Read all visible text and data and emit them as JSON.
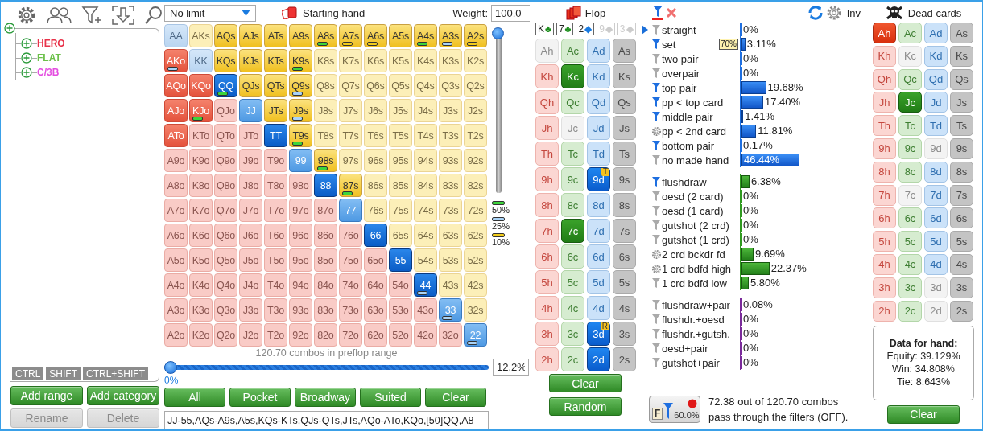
{
  "tree": {
    "items": [
      {
        "label": "HERO",
        "color": "#e8334a"
      },
      {
        "label": "FLAT",
        "color": "#6cc04a"
      },
      {
        "label": "C/3B",
        "color": "#e44ee0"
      }
    ]
  },
  "modifier_keys": [
    "CTRL",
    "SHIFT",
    "CTRL+SHIFT"
  ],
  "range_buttons": [
    {
      "label": "Add range",
      "disabled": false
    },
    {
      "label": "Add category",
      "disabled": false
    },
    {
      "label": "Rename",
      "disabled": true
    },
    {
      "label": "Delete",
      "disabled": true
    }
  ],
  "range": {
    "mode_dropdown": "No limit",
    "title": "Starting hand",
    "weight_label": "Weight:",
    "weight_value": "100.0",
    "weight_slider": {
      "level": 1
    },
    "legend": [
      {
        "label": "50%",
        "color": "#3cd43c"
      },
      {
        "label": "25%",
        "color": "#a9d3f7"
      },
      {
        "label": "10%",
        "color": "#f2cc1a"
      }
    ],
    "grid": [
      [
        {
          "label": "AA",
          "kind": "pair",
          "selected": false
        },
        {
          "label": "AKs",
          "kind": "suited",
          "selected": false
        },
        {
          "label": "AQs",
          "kind": "suited",
          "selected": true
        },
        {
          "label": "AJs",
          "kind": "suited",
          "selected": true
        },
        {
          "label": "ATs",
          "kind": "suited",
          "selected": true
        },
        {
          "label": "A9s",
          "kind": "suited",
          "selected": true
        },
        {
          "label": "A8s",
          "kind": "suited",
          "selected": true,
          "marker": {
            "color": "#3cd43c"
          }
        },
        {
          "label": "A7s",
          "kind": "suited",
          "selected": true,
          "marker": {
            "color": "#f2cc1a"
          }
        },
        {
          "label": "A6s",
          "kind": "suited",
          "selected": true,
          "marker": {
            "color": "#f2cc1a"
          }
        },
        {
          "label": "A5s",
          "kind": "suited",
          "selected": true
        },
        {
          "label": "A4s",
          "kind": "suited",
          "selected": true,
          "marker": {
            "color": "#3cd43c"
          }
        },
        {
          "label": "A3s",
          "kind": "suited",
          "selected": true,
          "marker": {
            "color": "#a9d3f7"
          }
        },
        {
          "label": "A2s",
          "kind": "suited",
          "selected": true,
          "marker": {
            "color": "#f2cc1a"
          }
        }
      ],
      [
        {
          "label": "AKo",
          "kind": "offsuit",
          "selected": true,
          "marker": {
            "color": "#a9d3f7"
          }
        },
        {
          "label": "KK",
          "kind": "pair",
          "selected": false
        },
        {
          "label": "KQs",
          "kind": "suited",
          "selected": true
        },
        {
          "label": "KJs",
          "kind": "suited",
          "selected": true
        },
        {
          "label": "KTs",
          "kind": "suited",
          "selected": true
        },
        {
          "label": "K9s",
          "kind": "suited",
          "selected": true,
          "marker": {
            "color": "#3cd43c"
          }
        },
        {
          "label": "K8s",
          "kind": "suited",
          "selected": false
        },
        {
          "label": "K7s",
          "kind": "suited",
          "selected": false
        },
        {
          "label": "K6s",
          "kind": "suited",
          "selected": false
        },
        {
          "label": "K5s",
          "kind": "suited",
          "selected": false
        },
        {
          "label": "K4s",
          "kind": "suited",
          "selected": false
        },
        {
          "label": "K3s",
          "kind": "suited",
          "selected": false
        },
        {
          "label": "K2s",
          "kind": "suited",
          "selected": false
        }
      ],
      [
        {
          "label": "AQo",
          "kind": "offsuit",
          "selected": true
        },
        {
          "label": "KQo",
          "kind": "offsuit",
          "selected": true
        },
        {
          "label": "QQ",
          "kind": "pair",
          "selected": true,
          "partial": false,
          "marker": {
            "color": "#3cd43c"
          }
        },
        {
          "label": "QJs",
          "kind": "suited",
          "selected": true
        },
        {
          "label": "QTs",
          "kind": "suited",
          "selected": true
        },
        {
          "label": "Q9s",
          "kind": "suited",
          "selected": true,
          "marker": {
            "color": "#a9d3f7"
          }
        },
        {
          "label": "Q8s",
          "kind": "suited",
          "selected": false
        },
        {
          "label": "Q7s",
          "kind": "suited",
          "selected": false
        },
        {
          "label": "Q6s",
          "kind": "suited",
          "selected": false
        },
        {
          "label": "Q5s",
          "kind": "suited",
          "selected": false
        },
        {
          "label": "Q4s",
          "kind": "suited",
          "selected": false
        },
        {
          "label": "Q3s",
          "kind": "suited",
          "selected": false
        },
        {
          "label": "Q2s",
          "kind": "suited",
          "selected": false
        }
      ],
      [
        {
          "label": "AJo",
          "kind": "offsuit",
          "selected": true
        },
        {
          "label": "KJo",
          "kind": "offsuit",
          "selected": true,
          "marker": {
            "color": "#3cd43c"
          }
        },
        {
          "label": "QJo",
          "kind": "offsuit",
          "selected": false
        },
        {
          "label": "JJ",
          "kind": "pair",
          "selected": true,
          "partial": true
        },
        {
          "label": "JTs",
          "kind": "suited",
          "selected": true
        },
        {
          "label": "J9s",
          "kind": "suited",
          "selected": true,
          "marker": {
            "color": "#a9d3f7"
          }
        },
        {
          "label": "J8s",
          "kind": "suited",
          "selected": false
        },
        {
          "label": "J7s",
          "kind": "suited",
          "selected": false
        },
        {
          "label": "J6s",
          "kind": "suited",
          "selected": false
        },
        {
          "label": "J5s",
          "kind": "suited",
          "selected": false
        },
        {
          "label": "J4s",
          "kind": "suited",
          "selected": false
        },
        {
          "label": "J3s",
          "kind": "suited",
          "selected": false
        },
        {
          "label": "J2s",
          "kind": "suited",
          "selected": false
        }
      ],
      [
        {
          "label": "ATo",
          "kind": "offsuit",
          "selected": true
        },
        {
          "label": "KTo",
          "kind": "offsuit",
          "selected": false
        },
        {
          "label": "QTo",
          "kind": "offsuit",
          "selected": false
        },
        {
          "label": "JTo",
          "kind": "offsuit",
          "selected": false
        },
        {
          "label": "TT",
          "kind": "pair",
          "selected": true,
          "partial": false
        },
        {
          "label": "T9s",
          "kind": "suited",
          "selected": true,
          "marker": {
            "color": "#3cd43c"
          }
        },
        {
          "label": "T8s",
          "kind": "suited",
          "selected": false
        },
        {
          "label": "T7s",
          "kind": "suited",
          "selected": false
        },
        {
          "label": "T6s",
          "kind": "suited",
          "selected": false
        },
        {
          "label": "T5s",
          "kind": "suited",
          "selected": false
        },
        {
          "label": "T4s",
          "kind": "suited",
          "selected": false
        },
        {
          "label": "T3s",
          "kind": "suited",
          "selected": false
        },
        {
          "label": "T2s",
          "kind": "suited",
          "selected": false
        }
      ],
      [
        {
          "label": "A9o",
          "kind": "offsuit",
          "selected": false
        },
        {
          "label": "K9o",
          "kind": "offsuit",
          "selected": false
        },
        {
          "label": "Q9o",
          "kind": "offsuit",
          "selected": false
        },
        {
          "label": "J9o",
          "kind": "offsuit",
          "selected": false
        },
        {
          "label": "T9o",
          "kind": "offsuit",
          "selected": false
        },
        {
          "label": "99",
          "kind": "pair",
          "selected": true,
          "partial": true
        },
        {
          "label": "98s",
          "kind": "suited",
          "selected": true,
          "marker": {
            "color": "#3cd43c"
          }
        },
        {
          "label": "97s",
          "kind": "suited",
          "selected": false
        },
        {
          "label": "96s",
          "kind": "suited",
          "selected": false
        },
        {
          "label": "95s",
          "kind": "suited",
          "selected": false
        },
        {
          "label": "94s",
          "kind": "suited",
          "selected": false
        },
        {
          "label": "93s",
          "kind": "suited",
          "selected": false
        },
        {
          "label": "92s",
          "kind": "suited",
          "selected": false
        }
      ],
      [
        {
          "label": "A8o",
          "kind": "offsuit",
          "selected": false
        },
        {
          "label": "K8o",
          "kind": "offsuit",
          "selected": false
        },
        {
          "label": "Q8o",
          "kind": "offsuit",
          "selected": false
        },
        {
          "label": "J8o",
          "kind": "offsuit",
          "selected": false
        },
        {
          "label": "T8o",
          "kind": "offsuit",
          "selected": false
        },
        {
          "label": "98o",
          "kind": "offsuit",
          "selected": false
        },
        {
          "label": "88",
          "kind": "pair",
          "selected": true,
          "partial": false
        },
        {
          "label": "87s",
          "kind": "suited",
          "selected": true,
          "marker": {
            "color": "#3cd43c"
          }
        },
        {
          "label": "86s",
          "kind": "suited",
          "selected": false
        },
        {
          "label": "85s",
          "kind": "suited",
          "selected": false
        },
        {
          "label": "84s",
          "kind": "suited",
          "selected": false
        },
        {
          "label": "83s",
          "kind": "suited",
          "selected": false
        },
        {
          "label": "82s",
          "kind": "suited",
          "selected": false
        }
      ],
      [
        {
          "label": "A7o",
          "kind": "offsuit",
          "selected": false
        },
        {
          "label": "K7o",
          "kind": "offsuit",
          "selected": false
        },
        {
          "label": "Q7o",
          "kind": "offsuit",
          "selected": false
        },
        {
          "label": "J7o",
          "kind": "offsuit",
          "selected": false
        },
        {
          "label": "T7o",
          "kind": "offsuit",
          "selected": false
        },
        {
          "label": "97o",
          "kind": "offsuit",
          "selected": false
        },
        {
          "label": "87o",
          "kind": "offsuit",
          "selected": false
        },
        {
          "label": "77",
          "kind": "pair",
          "selected": true,
          "partial": true
        },
        {
          "label": "76s",
          "kind": "suited",
          "selected": false
        },
        {
          "label": "75s",
          "kind": "suited",
          "selected": false
        },
        {
          "label": "74s",
          "kind": "suited",
          "selected": false
        },
        {
          "label": "73s",
          "kind": "suited",
          "selected": false
        },
        {
          "label": "72s",
          "kind": "suited",
          "selected": false
        }
      ],
      [
        {
          "label": "A6o",
          "kind": "offsuit",
          "selected": false
        },
        {
          "label": "K6o",
          "kind": "offsuit",
          "selected": false
        },
        {
          "label": "Q6o",
          "kind": "offsuit",
          "selected": false
        },
        {
          "label": "J6o",
          "kind": "offsuit",
          "selected": false
        },
        {
          "label": "T6o",
          "kind": "offsuit",
          "selected": false
        },
        {
          "label": "96o",
          "kind": "offsuit",
          "selected": false
        },
        {
          "label": "86o",
          "kind": "offsuit",
          "selected": false
        },
        {
          "label": "76o",
          "kind": "offsuit",
          "selected": false
        },
        {
          "label": "66",
          "kind": "pair",
          "selected": true,
          "partial": false
        },
        {
          "label": "65s",
          "kind": "suited",
          "selected": false
        },
        {
          "label": "64s",
          "kind": "suited",
          "selected": false
        },
        {
          "label": "63s",
          "kind": "suited",
          "selected": false
        },
        {
          "label": "62s",
          "kind": "suited",
          "selected": false
        }
      ],
      [
        {
          "label": "A5o",
          "kind": "offsuit",
          "selected": false
        },
        {
          "label": "K5o",
          "kind": "offsuit",
          "selected": false
        },
        {
          "label": "Q5o",
          "kind": "offsuit",
          "selected": false
        },
        {
          "label": "J5o",
          "kind": "offsuit",
          "selected": false
        },
        {
          "label": "T5o",
          "kind": "offsuit",
          "selected": false
        },
        {
          "label": "95o",
          "kind": "offsuit",
          "selected": false
        },
        {
          "label": "85o",
          "kind": "offsuit",
          "selected": false
        },
        {
          "label": "75o",
          "kind": "offsuit",
          "selected": false
        },
        {
          "label": "65o",
          "kind": "offsuit",
          "selected": false
        },
        {
          "label": "55",
          "kind": "pair",
          "selected": true,
          "partial": false
        },
        {
          "label": "54s",
          "kind": "suited",
          "selected": false
        },
        {
          "label": "53s",
          "kind": "suited",
          "selected": false
        },
        {
          "label": "52s",
          "kind": "suited",
          "selected": false
        }
      ],
      [
        {
          "label": "A4o",
          "kind": "offsuit",
          "selected": false
        },
        {
          "label": "K4o",
          "kind": "offsuit",
          "selected": false
        },
        {
          "label": "Q4o",
          "kind": "offsuit",
          "selected": false
        },
        {
          "label": "J4o",
          "kind": "offsuit",
          "selected": false
        },
        {
          "label": "T4o",
          "kind": "offsuit",
          "selected": false
        },
        {
          "label": "94o",
          "kind": "offsuit",
          "selected": false
        },
        {
          "label": "84o",
          "kind": "offsuit",
          "selected": false
        },
        {
          "label": "74o",
          "kind": "offsuit",
          "selected": false
        },
        {
          "label": "64o",
          "kind": "offsuit",
          "selected": false
        },
        {
          "label": "54o",
          "kind": "offsuit",
          "selected": false
        },
        {
          "label": "44",
          "kind": "pair",
          "selected": true,
          "partial": false,
          "marker": {
            "color": "#a9d3f7"
          }
        },
        {
          "label": "43s",
          "kind": "suited",
          "selected": false
        },
        {
          "label": "42s",
          "kind": "suited",
          "selected": false
        }
      ],
      [
        {
          "label": "A3o",
          "kind": "offsuit",
          "selected": false
        },
        {
          "label": "K3o",
          "kind": "offsuit",
          "selected": false
        },
        {
          "label": "Q3o",
          "kind": "offsuit",
          "selected": false
        },
        {
          "label": "J3o",
          "kind": "offsuit",
          "selected": false
        },
        {
          "label": "T3o",
          "kind": "offsuit",
          "selected": false
        },
        {
          "label": "93o",
          "kind": "offsuit",
          "selected": false
        },
        {
          "label": "83o",
          "kind": "offsuit",
          "selected": false
        },
        {
          "label": "73o",
          "kind": "offsuit",
          "selected": false
        },
        {
          "label": "63o",
          "kind": "offsuit",
          "selected": false
        },
        {
          "label": "53o",
          "kind": "offsuit",
          "selected": false
        },
        {
          "label": "43o",
          "kind": "offsuit",
          "selected": false
        },
        {
          "label": "33",
          "kind": "pair",
          "selected": true,
          "partial": true,
          "marker": {
            "color": "#a9d3f7"
          }
        },
        {
          "label": "32s",
          "kind": "suited",
          "selected": false
        }
      ],
      [
        {
          "label": "A2o",
          "kind": "offsuit",
          "selected": false
        },
        {
          "label": "K2o",
          "kind": "offsuit",
          "selected": false
        },
        {
          "label": "Q2o",
          "kind": "offsuit",
          "selected": false
        },
        {
          "label": "J2o",
          "kind": "offsuit",
          "selected": false
        },
        {
          "label": "T2o",
          "kind": "offsuit",
          "selected": false
        },
        {
          "label": "92o",
          "kind": "offsuit",
          "selected": false
        },
        {
          "label": "82o",
          "kind": "offsuit",
          "selected": false
        },
        {
          "label": "72o",
          "kind": "offsuit",
          "selected": false
        },
        {
          "label": "62o",
          "kind": "offsuit",
          "selected": false
        },
        {
          "label": "52o",
          "kind": "offsuit",
          "selected": false
        },
        {
          "label": "42o",
          "kind": "offsuit",
          "selected": false
        },
        {
          "label": "32o",
          "kind": "offsuit",
          "selected": false
        },
        {
          "label": "22",
          "kind": "pair",
          "selected": true,
          "partial": true,
          "marker": {
            "color": "#a9d3f7"
          }
        }
      ]
    ],
    "combos_caption": "120.70 combos in preflop range",
    "percent_slider": {
      "level": 0
    },
    "percent_min": "0%",
    "percent_value": "12.2%",
    "buttons": [
      "All",
      "Pocket",
      "Broadway",
      "Suited",
      "Clear"
    ],
    "range_text": "JJ-55,AQs-A9s,A5s,KQs-KTs,QJs-QTs,JTs,AQo-ATo,KQo,[50]QQ,A8"
  },
  "flop": {
    "title": "Flop",
    "board": [
      {
        "rank": "K",
        "suit": "♣",
        "active": true,
        "color": "#1f8f1f"
      },
      {
        "rank": "7",
        "suit": "♣",
        "active": true,
        "color": "#1f8f1f"
      },
      {
        "rank": "2",
        "suit": "◆",
        "active": true,
        "color": "#1a7be0"
      },
      {
        "rank": "9",
        "suit": "◆",
        "active": false
      },
      {
        "rank": "3",
        "suit": "◆",
        "active": false
      }
    ],
    "cards": [
      [
        {
          "label": "Ah",
          "selected": false,
          "disabled": true
        },
        {
          "label": "Ac",
          "selected": false,
          "disabled": false
        },
        {
          "label": "Ad",
          "selected": false,
          "disabled": false
        },
        {
          "label": "As",
          "selected": false,
          "disabled": false
        }
      ],
      [
        {
          "label": "Kh",
          "selected": false,
          "disabled": false
        },
        {
          "label": "Kc",
          "selected": true,
          "disabled": false
        },
        {
          "label": "Kd",
          "selected": false,
          "disabled": false
        },
        {
          "label": "Ks",
          "selected": false,
          "disabled": false
        }
      ],
      [
        {
          "label": "Qh",
          "selected": false,
          "disabled": false
        },
        {
          "label": "Qc",
          "selected": false,
          "disabled": false
        },
        {
          "label": "Qd",
          "selected": false,
          "disabled": false
        },
        {
          "label": "Qs",
          "selected": false,
          "disabled": false
        }
      ],
      [
        {
          "label": "Jh",
          "selected": false,
          "disabled": false
        },
        {
          "label": "Jc",
          "selected": false,
          "disabled": true
        },
        {
          "label": "Jd",
          "selected": false,
          "disabled": false
        },
        {
          "label": "Js",
          "selected": false,
          "disabled": false
        }
      ],
      [
        {
          "label": "Th",
          "selected": false,
          "disabled": false
        },
        {
          "label": "Tc",
          "selected": false,
          "disabled": false
        },
        {
          "label": "Td",
          "selected": false,
          "disabled": false
        },
        {
          "label": "Ts",
          "selected": false,
          "disabled": false
        }
      ],
      [
        {
          "label": "9h",
          "selected": false,
          "disabled": false
        },
        {
          "label": "9c",
          "selected": false,
          "disabled": false
        },
        {
          "label": "9d",
          "selected": true,
          "disabled": false,
          "badge": "T"
        },
        {
          "label": "9s",
          "selected": false,
          "disabled": false
        }
      ],
      [
        {
          "label": "8h",
          "selected": false,
          "disabled": false
        },
        {
          "label": "8c",
          "selected": false,
          "disabled": false
        },
        {
          "label": "8d",
          "selected": false,
          "disabled": false
        },
        {
          "label": "8s",
          "selected": false,
          "disabled": false
        }
      ],
      [
        {
          "label": "7h",
          "selected": false,
          "disabled": false
        },
        {
          "label": "7c",
          "selected": true,
          "disabled": false
        },
        {
          "label": "7d",
          "selected": false,
          "disabled": false
        },
        {
          "label": "7s",
          "selected": false,
          "disabled": false
        }
      ],
      [
        {
          "label": "6h",
          "selected": false,
          "disabled": false
        },
        {
          "label": "6c",
          "selected": false,
          "disabled": false
        },
        {
          "label": "6d",
          "selected": false,
          "disabled": false
        },
        {
          "label": "6s",
          "selected": false,
          "disabled": false
        }
      ],
      [
        {
          "label": "5h",
          "selected": false,
          "disabled": false
        },
        {
          "label": "5c",
          "selected": false,
          "disabled": false
        },
        {
          "label": "5d",
          "selected": false,
          "disabled": false
        },
        {
          "label": "5s",
          "selected": false,
          "disabled": false
        }
      ],
      [
        {
          "label": "4h",
          "selected": false,
          "disabled": false
        },
        {
          "label": "4c",
          "selected": false,
          "disabled": false
        },
        {
          "label": "4d",
          "selected": false,
          "disabled": false
        },
        {
          "label": "4s",
          "selected": false,
          "disabled": false
        }
      ],
      [
        {
          "label": "3h",
          "selected": false,
          "disabled": false
        },
        {
          "label": "3c",
          "selected": false,
          "disabled": false
        },
        {
          "label": "3d",
          "selected": true,
          "disabled": false,
          "badge": "R"
        },
        {
          "label": "3s",
          "selected": false,
          "disabled": false
        }
      ],
      [
        {
          "label": "2h",
          "selected": false,
          "disabled": false
        },
        {
          "label": "2c",
          "selected": false,
          "disabled": false
        },
        {
          "label": "2d",
          "selected": true,
          "disabled": false
        },
        {
          "label": "2s",
          "selected": false,
          "disabled": false
        }
      ]
    ],
    "buttons": [
      "Clear",
      "Random"
    ]
  },
  "stats": {
    "header_button": "Inv",
    "groups": [
      {
        "color": "#1e6fe0",
        "items": [
          {
            "label": "straight",
            "kind": "funnel",
            "active": false,
            "current": true,
            "value": "0%",
            "level": 0
          },
          {
            "label": "set",
            "kind": "funnel",
            "active": true,
            "current": false,
            "tag": "70%",
            "value": "3.11%",
            "level": 0.0311
          },
          {
            "label": "two pair",
            "kind": "funnel",
            "active": false,
            "current": false,
            "value": "0%",
            "level": 0
          },
          {
            "label": "overpair",
            "kind": "funnel",
            "active": false,
            "current": false,
            "value": "0%",
            "level": 0
          },
          {
            "label": "top pair",
            "kind": "funnel",
            "active": true,
            "current": false,
            "value": "19.68%",
            "level": 0.1968
          },
          {
            "label": "pp < top card",
            "kind": "funnel",
            "active": true,
            "current": false,
            "value": "17.40%",
            "level": 0.174
          },
          {
            "label": "middle pair",
            "kind": "funnel",
            "active": true,
            "current": false,
            "value": "1.41%",
            "level": 0.0141
          },
          {
            "label": "pp < 2nd card",
            "kind": "settings",
            "current": false,
            "value": "11.81%",
            "level": 0.1181
          },
          {
            "label": "bottom pair",
            "kind": "funnel",
            "active": true,
            "current": false,
            "value": "0.17%",
            "level": 0.0017
          },
          {
            "label": "no made hand",
            "kind": "funnel",
            "active": false,
            "current": false,
            "value": "46.44%",
            "level": 0.4644
          }
        ]
      },
      {
        "color": "#2f9a1f",
        "items": [
          {
            "label": "flushdraw",
            "kind": "funnel",
            "active": true,
            "current": false,
            "value": "6.38%",
            "level": 0.0638
          },
          {
            "label": "oesd (2 card)",
            "kind": "funnel",
            "active": false,
            "current": false,
            "value": "0%",
            "level": 0
          },
          {
            "label": "oesd (1 card)",
            "kind": "funnel",
            "active": false,
            "current": false,
            "value": "0%",
            "level": 0
          },
          {
            "label": "gutshot (2 crd)",
            "kind": "funnel",
            "active": false,
            "current": false,
            "value": "0%",
            "level": 0
          },
          {
            "label": "gutshot (1 crd)",
            "kind": "funnel",
            "active": false,
            "current": false,
            "value": "0%",
            "level": 0
          },
          {
            "label": "2 crd bckdr fd",
            "kind": "settings",
            "current": false,
            "value": "9.69%",
            "level": 0.0969
          },
          {
            "label": "1 crd bdfd high",
            "kind": "settings",
            "current": false,
            "value": "22.37%",
            "level": 0.2237
          },
          {
            "label": "1 crd bdfd low",
            "kind": "funnel",
            "active": false,
            "current": false,
            "value": "5.80%",
            "level": 0.058
          }
        ]
      },
      {
        "color": "#7a2a9a",
        "items": [
          {
            "label": "flushdraw+pair",
            "kind": "funnel",
            "active": false,
            "current": false,
            "value": "0.08%",
            "level": 0.0008
          },
          {
            "label": "flushdr.+oesd",
            "kind": "funnel",
            "active": false,
            "current": false,
            "value": "0%",
            "level": 0
          },
          {
            "label": "flushdr.+gutsh.",
            "kind": "funnel",
            "active": false,
            "current": false,
            "value": "0%",
            "level": 0
          },
          {
            "label": "oesd+pair",
            "kind": "funnel",
            "active": false,
            "current": false,
            "value": "0%",
            "level": 0
          },
          {
            "label": "gutshot+pair",
            "kind": "funnel",
            "active": false,
            "current": false,
            "value": "0%",
            "level": 0
          }
        ]
      }
    ],
    "filter_button": {
      "letter": "F",
      "value": "60.0%"
    },
    "filter_summary": "72.38 out of 120.70 combos pass through the filters (OFF)."
  },
  "dead": {
    "title": "Dead cards",
    "cards": [
      [
        {
          "label": "Ah",
          "selected": true,
          "disabled": false
        },
        {
          "label": "Ac",
          "selected": false,
          "disabled": false
        },
        {
          "label": "Ad",
          "selected": false,
          "disabled": false
        },
        {
          "label": "As",
          "selected": false,
          "disabled": false
        }
      ],
      [
        {
          "label": "Kh",
          "selected": false,
          "disabled": false
        },
        {
          "label": "Kc",
          "selected": false,
          "disabled": true
        },
        {
          "label": "Kd",
          "selected": false,
          "disabled": false
        },
        {
          "label": "Ks",
          "selected": false,
          "disabled": false
        }
      ],
      [
        {
          "label": "Qh",
          "selected": false,
          "disabled": false
        },
        {
          "label": "Qc",
          "selected": false,
          "disabled": false
        },
        {
          "label": "Qd",
          "selected": false,
          "disabled": false
        },
        {
          "label": "Qs",
          "selected": false,
          "disabled": false
        }
      ],
      [
        {
          "label": "Jh",
          "selected": false,
          "disabled": false
        },
        {
          "label": "Jc",
          "selected": true,
          "disabled": false
        },
        {
          "label": "Jd",
          "selected": false,
          "disabled": false
        },
        {
          "label": "Js",
          "selected": false,
          "disabled": false
        }
      ],
      [
        {
          "label": "Th",
          "selected": false,
          "disabled": false
        },
        {
          "label": "Tc",
          "selected": false,
          "disabled": false
        },
        {
          "label": "Td",
          "selected": false,
          "disabled": false
        },
        {
          "label": "Ts",
          "selected": false,
          "disabled": false
        }
      ],
      [
        {
          "label": "9h",
          "selected": false,
          "disabled": false
        },
        {
          "label": "9c",
          "selected": false,
          "disabled": false
        },
        {
          "label": "9d",
          "selected": false,
          "disabled": true
        },
        {
          "label": "9s",
          "selected": false,
          "disabled": false
        }
      ],
      [
        {
          "label": "8h",
          "selected": false,
          "disabled": false
        },
        {
          "label": "8c",
          "selected": false,
          "disabled": false
        },
        {
          "label": "8d",
          "selected": false,
          "disabled": false
        },
        {
          "label": "8s",
          "selected": false,
          "disabled": false
        }
      ],
      [
        {
          "label": "7h",
          "selected": false,
          "disabled": false
        },
        {
          "label": "7c",
          "selected": false,
          "disabled": true
        },
        {
          "label": "7d",
          "selected": false,
          "disabled": false
        },
        {
          "label": "7s",
          "selected": false,
          "disabled": false
        }
      ],
      [
        {
          "label": "6h",
          "selected": false,
          "disabled": false
        },
        {
          "label": "6c",
          "selected": false,
          "disabled": false
        },
        {
          "label": "6d",
          "selected": false,
          "disabled": false
        },
        {
          "label": "6s",
          "selected": false,
          "disabled": false
        }
      ],
      [
        {
          "label": "5h",
          "selected": false,
          "disabled": false
        },
        {
          "label": "5c",
          "selected": false,
          "disabled": false
        },
        {
          "label": "5d",
          "selected": false,
          "disabled": false
        },
        {
          "label": "5s",
          "selected": false,
          "disabled": false
        }
      ],
      [
        {
          "label": "4h",
          "selected": false,
          "disabled": false
        },
        {
          "label": "4c",
          "selected": false,
          "disabled": false
        },
        {
          "label": "4d",
          "selected": false,
          "disabled": false
        },
        {
          "label": "4s",
          "selected": false,
          "disabled": false
        }
      ],
      [
        {
          "label": "3h",
          "selected": false,
          "disabled": false
        },
        {
          "label": "3c",
          "selected": false,
          "disabled": false
        },
        {
          "label": "3d",
          "selected": false,
          "disabled": true
        },
        {
          "label": "3s",
          "selected": false,
          "disabled": false
        }
      ],
      [
        {
          "label": "2h",
          "selected": false,
          "disabled": false
        },
        {
          "label": "2c",
          "selected": false,
          "disabled": false
        },
        {
          "label": "2d",
          "selected": false,
          "disabled": true
        },
        {
          "label": "2s",
          "selected": false,
          "disabled": false
        }
      ]
    ],
    "info_title": "Data for hand:",
    "info_lines": [
      "Equity: 39.129%",
      "Win: 34.808%",
      "Tie: 8.643%"
    ],
    "button": "Clear"
  }
}
